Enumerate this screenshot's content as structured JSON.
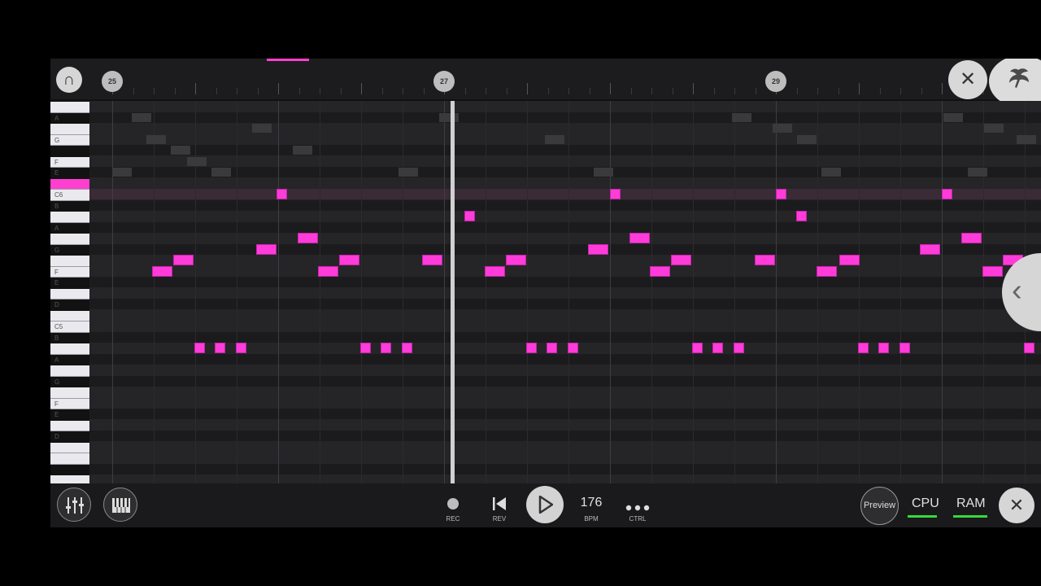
{
  "toolbar": {
    "snap_icon": "magnet-icon",
    "bar_markers": [
      "25",
      "27",
      "29"
    ],
    "close_icon": "close-icon",
    "logo_icon": "fl-fruit-logo-icon"
  },
  "keyboard": {
    "highlighted_key": "C6",
    "labels": [
      "A",
      "G",
      "F",
      "E",
      "C6",
      "B",
      "A",
      "G",
      "F",
      "E",
      "D",
      "C5",
      "B",
      "A",
      "G",
      "F",
      "E",
      "D"
    ]
  },
  "grid": {
    "note_color": "#ff3cd9",
    "notes_description": "melody pattern repeating each bar"
  },
  "transport": {
    "rec_label": "REC",
    "rev_label": "REV",
    "play_icon": "play-icon",
    "bpm_value": "176",
    "bpm_label": "BPM",
    "ctrl_label": "CTRL",
    "preview_label": "Preview",
    "cpu_label": "CPU",
    "ram_label": "RAM",
    "meter_color": "#35d93c",
    "mixer_icon": "mixer-sliders-icon",
    "piano_icon": "piano-keys-icon",
    "close_icon": "close-icon"
  }
}
